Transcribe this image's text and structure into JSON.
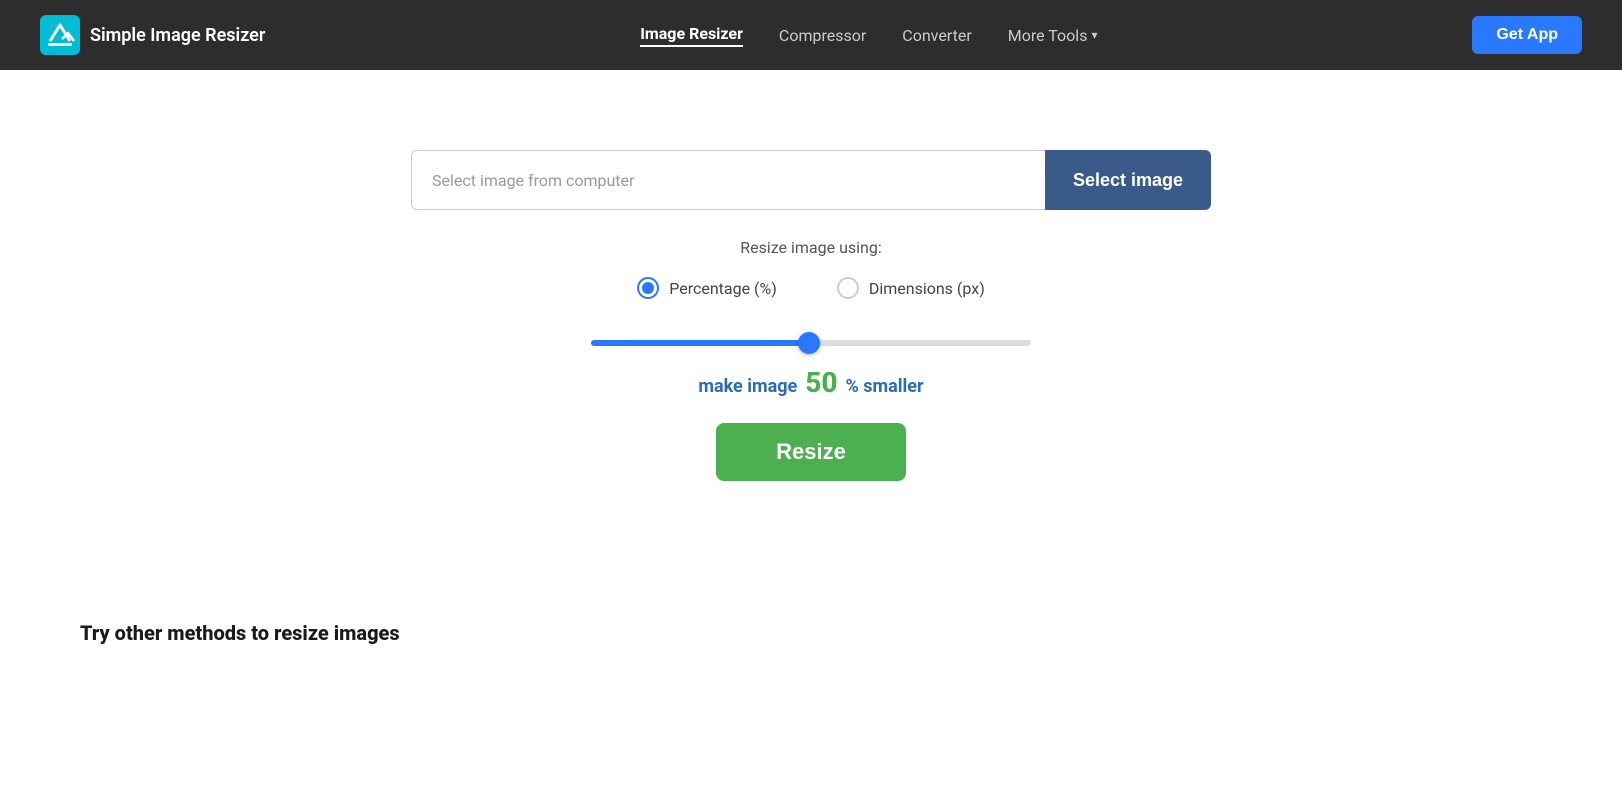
{
  "header": {
    "logo_text": "Simple Image Resizer",
    "nav": {
      "image_resizer": "Image Resizer",
      "compressor": "Compressor",
      "converter": "Converter",
      "more_tools": "More Tools",
      "get_app": "Get App"
    }
  },
  "main": {
    "file_input_placeholder": "Select image from computer",
    "select_image_btn": "Select image",
    "resize_label": "Resize image using:",
    "radio": {
      "percentage": "Percentage (%)",
      "dimensions": "Dimensions (px)"
    },
    "slider_value": 50,
    "percentage_text": {
      "make_image": "make image",
      "number": "50",
      "smaller": "% smaller"
    },
    "resize_btn": "Resize"
  },
  "bottom": {
    "try_other_title": "Try other methods to resize images"
  },
  "icons": {
    "logo": "share-icon",
    "chevron_down": "▾"
  }
}
